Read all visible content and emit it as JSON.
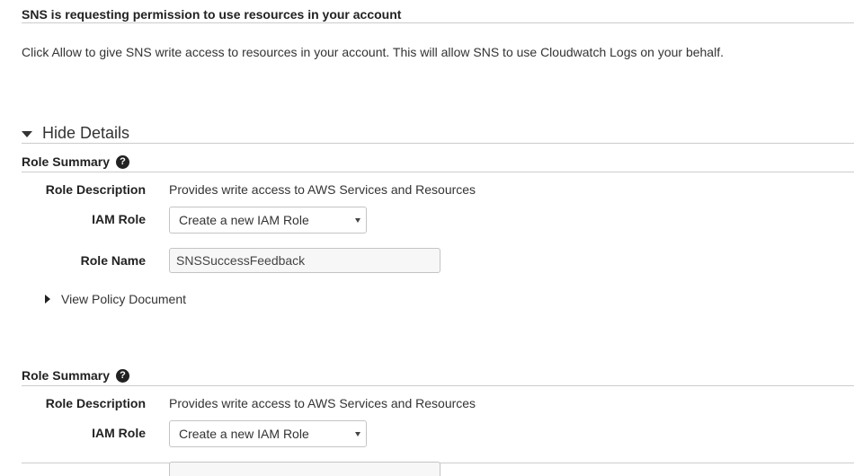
{
  "header": {
    "title": "SNS is requesting permission to use resources in your account"
  },
  "intro": {
    "text": "Click Allow to give SNS write access to resources in your account. This will allow SNS to use Cloudwatch Logs on your behalf."
  },
  "details_toggle": {
    "label": "Hide Details",
    "icon": "caret-down-icon"
  },
  "role_summary_1": {
    "title": "Role Summary",
    "help_icon": "?",
    "description_label": "Role Description",
    "description_value": "Provides write access to AWS Services and Resources",
    "iam_role_label": "IAM Role",
    "iam_role_selected": "Create a new IAM Role",
    "role_name_label": "Role Name",
    "role_name_value": "SNSSuccessFeedback",
    "policy_toggle_label": "View Policy Document"
  },
  "role_summary_2": {
    "title": "Role Summary",
    "help_icon": "?",
    "description_label": "Role Description",
    "description_value": "Provides write access to AWS Services and Resources",
    "iam_role_label": "IAM Role",
    "iam_role_selected": "Create a new IAM Role"
  }
}
